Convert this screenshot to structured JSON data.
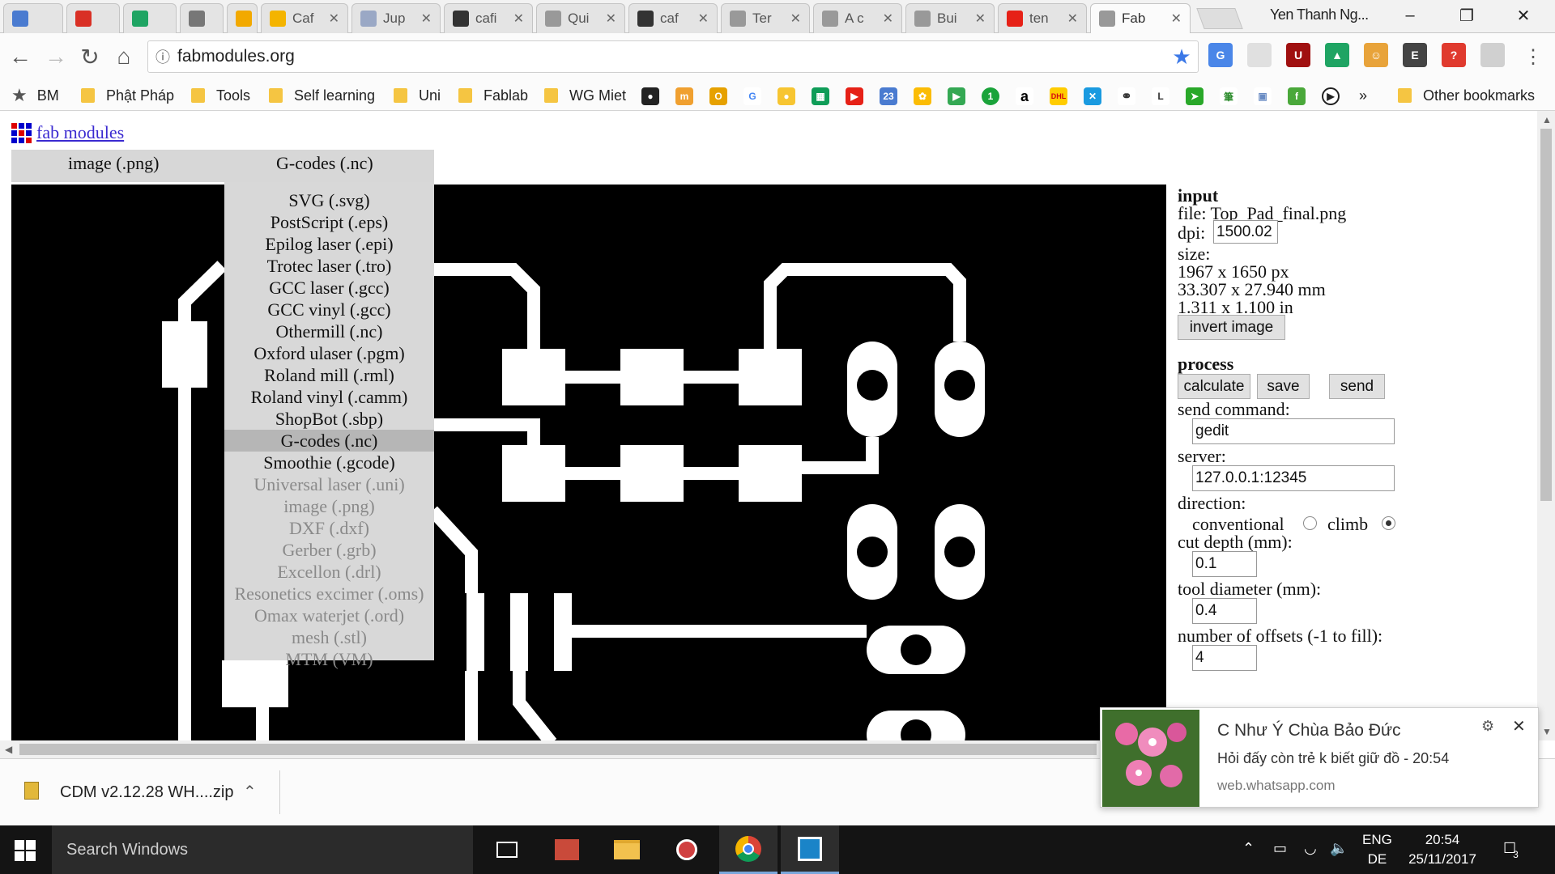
{
  "browser": {
    "tabs": [
      {
        "label": "",
        "icon": "calendar-icon",
        "color": "#4a7bd0"
      },
      {
        "label": "",
        "icon": "gmail-icon",
        "color": "#d93025"
      },
      {
        "label": "",
        "icon": "drive-icon",
        "color": "#1fa463"
      },
      {
        "label": "",
        "icon": "audio-icon",
        "color": "#777777"
      },
      {
        "label": "",
        "icon": "app-icon",
        "color": "#f2a900"
      },
      {
        "label": "Caf",
        "icon": "slides-icon",
        "color": "#f4b400"
      },
      {
        "label": "Jup",
        "icon": "notebook-icon",
        "color": "#9aa8c5"
      },
      {
        "label": "cafi",
        "icon": "github-icon",
        "color": "#333333"
      },
      {
        "label": "Qui",
        "icon": "page-icon",
        "color": "#999999"
      },
      {
        "label": "caf",
        "icon": "github-icon",
        "color": "#333333"
      },
      {
        "label": "Ter",
        "icon": "page-icon",
        "color": "#999999"
      },
      {
        "label": "A c",
        "icon": "page-icon",
        "color": "#999999"
      },
      {
        "label": "Bui",
        "icon": "page-icon",
        "color": "#999999"
      },
      {
        "label": "ten",
        "icon": "youtube-icon",
        "color": "#e62117"
      },
      {
        "label": "Fab",
        "icon": "page-icon",
        "color": "#999999",
        "active": true
      }
    ],
    "profile_name": "Yen Thanh Ng...",
    "url": "fabmodules.org"
  },
  "bookmarks": {
    "items": [
      "BM",
      "Phật Pháp",
      "Tools",
      "Self learning",
      "Uni",
      "Fablab",
      "WG Miet"
    ],
    "more": "»",
    "other": "Other bookmarks"
  },
  "page": {
    "logo_text": "fab modules",
    "menu": {
      "input_format": "image (.png)",
      "output_format": "G-codes (.nc)"
    },
    "dropdown": [
      {
        "label": "SVG (.svg)",
        "enabled": true
      },
      {
        "label": "PostScript (.eps)",
        "enabled": true
      },
      {
        "label": "Epilog laser (.epi)",
        "enabled": true
      },
      {
        "label": "Trotec laser (.tro)",
        "enabled": true
      },
      {
        "label": "GCC laser (.gcc)",
        "enabled": true
      },
      {
        "label": "GCC vinyl (.gcc)",
        "enabled": true
      },
      {
        "label": "Othermill (.nc)",
        "enabled": true
      },
      {
        "label": "Oxford ulaser (.pgm)",
        "enabled": true
      },
      {
        "label": "Roland mill (.rml)",
        "enabled": true
      },
      {
        "label": "Roland vinyl (.camm)",
        "enabled": true
      },
      {
        "label": "ShopBot (.sbp)",
        "enabled": true
      },
      {
        "label": "G-codes (.nc)",
        "enabled": true,
        "highlighted": true
      },
      {
        "label": "Smoothie (.gcode)",
        "enabled": true
      },
      {
        "label": "Universal laser (.uni)",
        "enabled": false
      },
      {
        "label": "image (.png)",
        "enabled": false
      },
      {
        "label": "DXF (.dxf)",
        "enabled": false
      },
      {
        "label": "Gerber (.grb)",
        "enabled": false
      },
      {
        "label": "Excellon (.drl)",
        "enabled": false
      },
      {
        "label": "Resonetics excimer (.oms)",
        "enabled": false
      },
      {
        "label": "Omax waterjet (.ord)",
        "enabled": false
      },
      {
        "label": "mesh (.stl)",
        "enabled": false
      },
      {
        "label": "MTM (VM)",
        "enabled": false
      }
    ],
    "input": {
      "heading": "input",
      "file_label": "file:",
      "file_name": "Top_Pad_final.png",
      "dpi_label": "dpi:",
      "dpi_value": "1500.02",
      "size_label": "size:",
      "size_px": "1967 x 1650 px",
      "size_mm": "33.307 x 27.940 mm",
      "size_in": "1.311 x 1.100 in",
      "invert_button": "invert image"
    },
    "process": {
      "heading": "process",
      "calculate": "calculate",
      "save": "save",
      "send": "send",
      "send_command_label": "send command:",
      "send_command_value": "gedit",
      "server_label": "server:",
      "server_value": "127.0.0.1:12345",
      "direction_label": "direction:",
      "conventional_label": "conventional",
      "climb_label": "climb",
      "direction_selected": "climb",
      "cut_depth_label": "cut depth (mm):",
      "cut_depth_value": "0.1",
      "tool_diameter_label": "tool diameter (mm):",
      "tool_diameter_value": "0.4",
      "offsets_label": "number of offsets (-1 to fill):",
      "offsets_value": "4"
    }
  },
  "downloads": {
    "file_name": "CDM v2.12.28 WH....zip"
  },
  "notification": {
    "title": "C Như Ý Chùa Bảo Đức",
    "message": "Hỏi đấy còn trẻ k biết giữ đồ - 20:54",
    "source": "web.whatsapp.com"
  },
  "taskbar": {
    "search_placeholder": "Search Windows",
    "lang_top": "ENG",
    "lang_bottom": "DE",
    "time": "20:54",
    "date": "25/11/2017",
    "notification_count": "3"
  }
}
